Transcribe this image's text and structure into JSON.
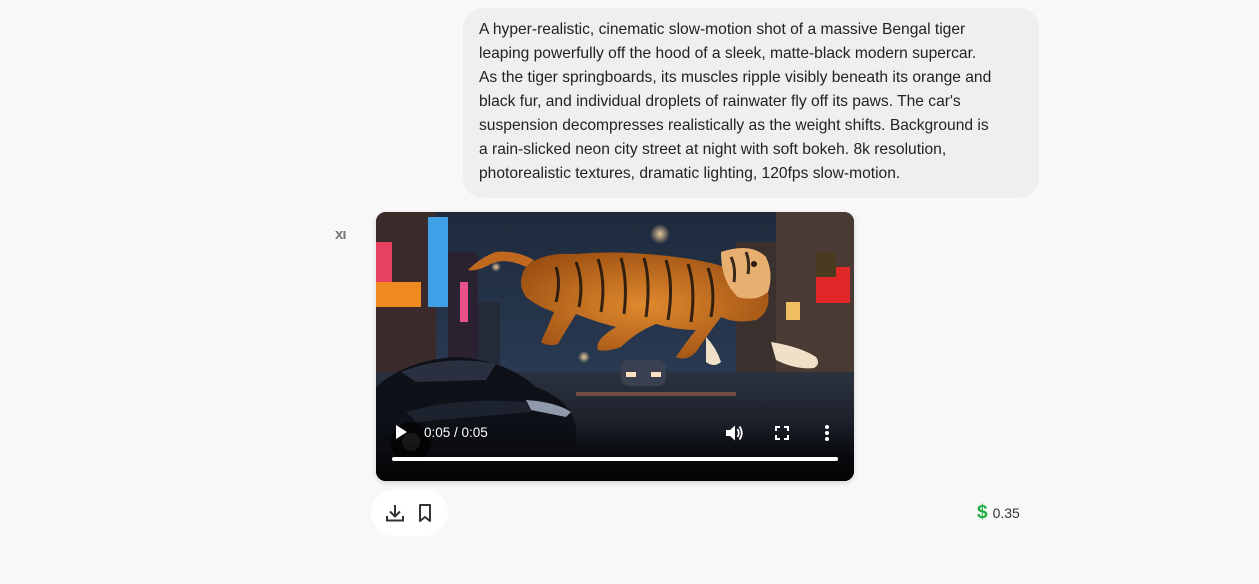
{
  "prompt": {
    "lines": [
      "A hyper-realistic, cinematic slow-motion shot of a massive Bengal tiger",
      "leaping powerfully off the hood of a sleek, matte-black modern supercar.",
      "As the tiger springboards, its muscles ripple visibly beneath its orange and",
      "black fur, and individual droplets of rainwater fly off its paws. The car's",
      "suspension decompresses realistically as the weight shifts. Background is",
      "a rain-slicked neon city street at night with soft bokeh. 8k resolution,",
      "photorealistic textures, dramatic lighting, 120fps slow-motion."
    ]
  },
  "model_icon": {
    "icon": "model-logo-icon",
    "text": "xı"
  },
  "video": {
    "time_display": "0:05 / 0:05",
    "progress": 1.0,
    "icons": {
      "play": "play-icon",
      "volume": "volume-icon",
      "fullscreen": "fullscreen-icon",
      "more": "more-vert-icon"
    }
  },
  "actions": {
    "download_icon": "download-icon",
    "bookmark_icon": "bookmark-icon"
  },
  "cost": {
    "symbol": "$",
    "value": "0.35",
    "color": "#1fae3e"
  }
}
